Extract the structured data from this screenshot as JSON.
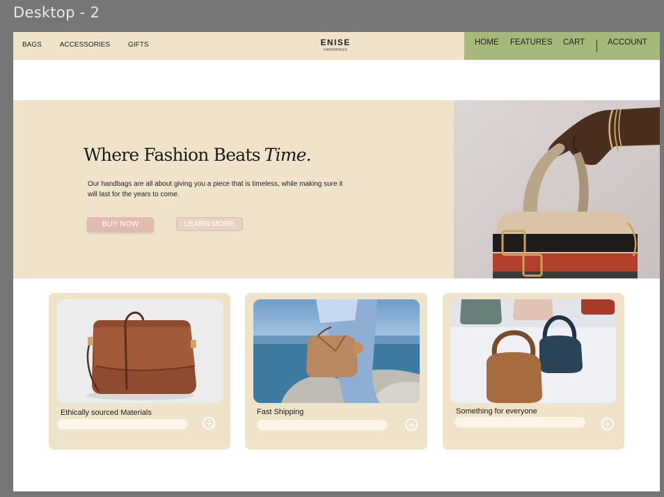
{
  "frame": {
    "title": "Desktop - 2"
  },
  "nav": {
    "left_links": [
      "BAGS",
      "ACCESSORIES",
      "GIFTS"
    ],
    "brand": {
      "name": "ENISE",
      "subtitle": "HANDBAGS"
    },
    "right_links": {
      "home": "HOME",
      "features": "FEATURES",
      "cart": "CART",
      "account": "ACCOUNT"
    },
    "colors": {
      "bar": "#efe4c9",
      "right_panel": "#a6b87a"
    }
  },
  "hero": {
    "title_main": "Where Fashion Beats",
    "title_accent": "Time.",
    "description": "Our handbags are all about giving you a piece that is timeless, while making sure it will last for the years to come.",
    "buy_label": "BUY NOW",
    "learn_label": "LEARN MORE",
    "image_icon": "hand-holding-handbag-photo"
  },
  "cards": [
    {
      "label": "Ethically sourced Materials",
      "image_icon": "brown-crossbody-bag-photo"
    },
    {
      "label": "Fast Shipping",
      "image_icon": "tan-bag-seaside-photo"
    },
    {
      "label": "Something for everyone",
      "image_icon": "assorted-handbags-photo"
    }
  ],
  "colors": {
    "accent_beige": "#efe4c9",
    "button_pink": "#e1bbb1",
    "pill": "#fbf5e8"
  }
}
